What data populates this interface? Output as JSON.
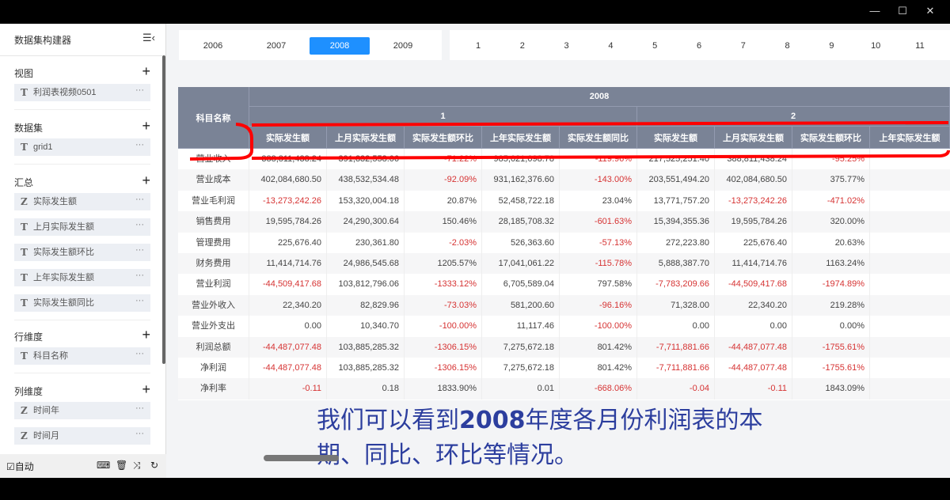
{
  "window": {
    "minimize": "—",
    "maximize": "☐",
    "close": "✕"
  },
  "sidebar": {
    "title": "数据集构建器",
    "sections": [
      {
        "label": "视图",
        "items": [
          {
            "type": "T",
            "label": "利润表视频0501"
          }
        ]
      },
      {
        "label": "数据集",
        "items": [
          {
            "type": "T",
            "label": "grid1"
          }
        ]
      },
      {
        "label": "汇总",
        "items": [
          {
            "type": "Z",
            "label": "实际发生额"
          },
          {
            "type": "T",
            "label": "上月实际发生额"
          },
          {
            "type": "T",
            "label": "实际发生额环比"
          },
          {
            "type": "T",
            "label": "上年实际发生额"
          },
          {
            "type": "T",
            "label": "实际发生额同比"
          }
        ]
      },
      {
        "label": "行维度",
        "items": [
          {
            "type": "T",
            "label": "科目名称"
          }
        ]
      },
      {
        "label": "列维度",
        "items": [
          {
            "type": "Z",
            "label": "时间年"
          },
          {
            "type": "Z",
            "label": "时间月"
          }
        ]
      }
    ],
    "footer": {
      "auto_label": "☑自动"
    }
  },
  "years": [
    "2006",
    "2007",
    "2008",
    "2009"
  ],
  "active_year": "2008",
  "months": [
    "1",
    "2",
    "3",
    "4",
    "5",
    "6",
    "7",
    "8",
    "9",
    "10",
    "11"
  ],
  "table": {
    "row_header": "科目名称",
    "year": "2008",
    "month_groups": [
      "1",
      "2"
    ],
    "columns": [
      "实际发生额",
      "上月实际发生额",
      "实际发生额环比",
      "上年实际发生额",
      "实际发生额同比",
      "实际发生额",
      "上月实际发生额",
      "实际发生额环比",
      "上年实际发生额"
    ],
    "rows": [
      {
        "name": "营业收入",
        "values": [
          "388,811,438.24",
          "391,832,558.06",
          "-71.22%",
          "985,021,098.78",
          "-119.96%",
          "217,525,251.40",
          "388,811,438.24",
          "-95.25%"
        ]
      },
      {
        "name": "营业成本",
        "values": [
          "402,084,680.50",
          "438,532,534.48",
          "-92.09%",
          "931,162,376.60",
          "-143.00%",
          "203,551,494.20",
          "402,084,680.50",
          "375.77%"
        ]
      },
      {
        "name": "营业毛利润",
        "values": [
          "-13,273,242.26",
          "153,320,004.18",
          "20.87%",
          "52,458,722.18",
          "23.04%",
          "13,771,757.20",
          "-13,273,242.26",
          "-471.02%"
        ]
      },
      {
        "name": "销售费用",
        "values": [
          "19,595,784.26",
          "24,290,300.64",
          "150.46%",
          "28,185,708.32",
          "-601.63%",
          "15,394,355.36",
          "19,595,784.26",
          "320.00%"
        ]
      },
      {
        "name": "管理费用",
        "values": [
          "225,676.40",
          "230,361.80",
          "-2.03%",
          "526,363.60",
          "-57.13%",
          "272,223.80",
          "225,676.40",
          "20.63%"
        ]
      },
      {
        "name": "财务费用",
        "values": [
          "11,414,714.76",
          "24,986,545.68",
          "1205.57%",
          "17,041,061.22",
          "-115.78%",
          "5,888,387.70",
          "11,414,714.76",
          "1163.24%"
        ]
      },
      {
        "name": "营业利润",
        "values": [
          "-44,509,417.68",
          "103,812,796.06",
          "-1333.12%",
          "6,705,589.04",
          "797.58%",
          "-7,783,209.66",
          "-44,509,417.68",
          "-1974.89%"
        ]
      },
      {
        "name": "营业外收入",
        "values": [
          "22,340.20",
          "82,829.96",
          "-73.03%",
          "581,200.60",
          "-96.16%",
          "71,328.00",
          "22,340.20",
          "219.28%"
        ]
      },
      {
        "name": "营业外支出",
        "values": [
          "0.00",
          "10,340.70",
          "-100.00%",
          "11,117.46",
          "-100.00%",
          "0.00",
          "0.00",
          "0.00%"
        ]
      },
      {
        "name": "利润总额",
        "values": [
          "-44,487,077.48",
          "103,885,285.32",
          "-1306.15%",
          "7,275,672.18",
          "801.42%",
          "-7,711,881.66",
          "-44,487,077.48",
          "-1755.61%"
        ]
      },
      {
        "name": "净利润",
        "values": [
          "-44,487,077.48",
          "103,885,285.32",
          "-1306.15%",
          "7,275,672.18",
          "801.42%",
          "-7,711,881.66",
          "-44,487,077.48",
          "-1755.61%"
        ]
      },
      {
        "name": "净利率",
        "values": [
          "-0.11",
          "0.18",
          "1833.90%",
          "0.01",
          "-668.06%",
          "-0.04",
          "-0.11",
          "1843.09%"
        ]
      }
    ]
  },
  "subtitle": {
    "line1_a": "我们可以看到",
    "line1_b": "2008",
    "line1_c": "年度各月份利润表的本",
    "line2": "期、同比、环比等情况。"
  },
  "colors": {
    "accent": "#1e90ff",
    "header": "#7a8396",
    "negative": "#d63333",
    "annotation": "#ff0000"
  }
}
